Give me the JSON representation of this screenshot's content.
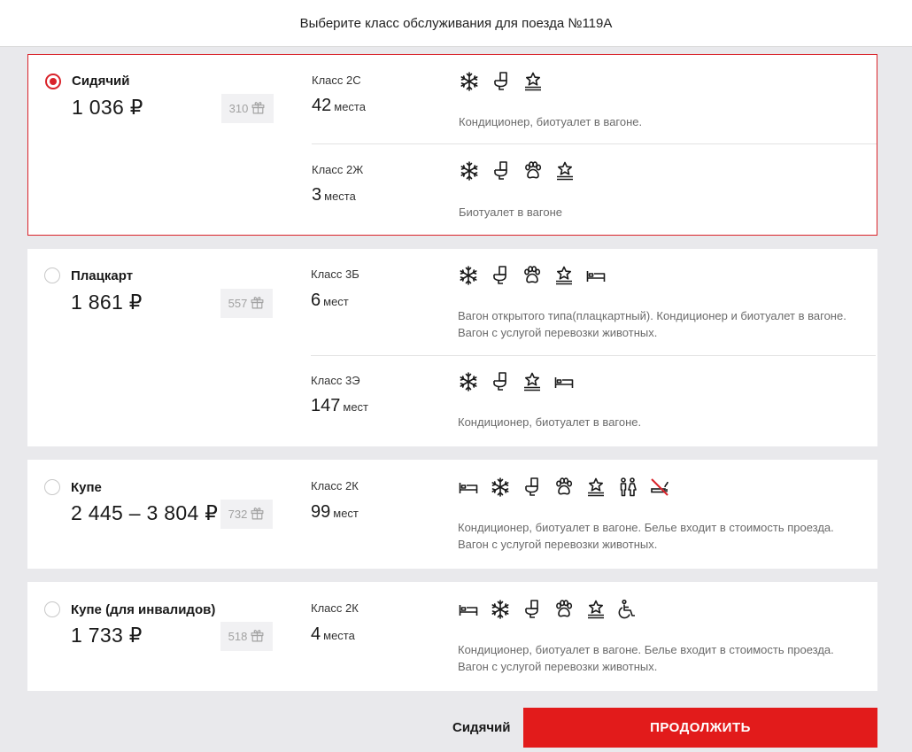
{
  "header": {
    "title": "Выберите класс обслуживания для поезда №119А"
  },
  "classes": [
    {
      "name": "Сидячий",
      "price": "1 036 ₽",
      "bonus": "310",
      "selected": true,
      "subclasses": [
        {
          "label": "Класс 2С",
          "seats": "42",
          "unit": "места",
          "icons": [
            "snowflake-icon",
            "toilet-icon",
            "service-icon"
          ],
          "desc": "Кондиционер, биотуалет в вагоне."
        },
        {
          "label": "Класс 2Ж",
          "seats": "3",
          "unit": "места",
          "icons": [
            "snowflake-icon",
            "toilet-icon",
            "paw-icon",
            "service-icon"
          ],
          "desc": "Биотуалет в вагоне"
        }
      ]
    },
    {
      "name": "Плацкарт",
      "price": "1 861 ₽",
      "bonus": "557",
      "selected": false,
      "subclasses": [
        {
          "label": "Класс 3Б",
          "seats": "6",
          "unit": "мест",
          "icons": [
            "snowflake-icon",
            "toilet-icon",
            "paw-icon",
            "service-icon",
            "bed-icon"
          ],
          "desc": "Вагон открытого типа(плацкартный). Кондиционер и биотуалет в вагоне. Вагон с услугой перевозки животных."
        },
        {
          "label": "Класс 3Э",
          "seats": "147",
          "unit": "мест",
          "icons": [
            "snowflake-icon",
            "toilet-icon",
            "service-icon",
            "bed-icon"
          ],
          "desc": "Кондиционер, биотуалет в вагоне."
        }
      ]
    },
    {
      "name": "Купе",
      "price": "2 445 – 3 804 ₽",
      "bonus": "732",
      "selected": false,
      "subclasses": [
        {
          "label": "Класс 2К",
          "seats": "99",
          "unit": "мест",
          "icons": [
            "bed-icon",
            "snowflake-icon",
            "toilet-icon",
            "paw-icon",
            "service-icon",
            "gender-icon",
            "no-smoking-icon"
          ],
          "desc": "Кондиционер, биотуалет в вагоне. Белье входит в стоимость проезда. Вагон с услугой перевозки животных."
        }
      ]
    },
    {
      "name": "Купе (для инвалидов)",
      "price": "1 733 ₽",
      "bonus": "518",
      "selected": false,
      "subclasses": [
        {
          "label": "Класс 2К",
          "seats": "4",
          "unit": "места",
          "icons": [
            "bed-icon",
            "snowflake-icon",
            "toilet-icon",
            "paw-icon",
            "service-icon",
            "wheelchair-icon"
          ],
          "desc": "Кондиционер, биотуалет в вагоне. Белье входит в стоимость проезда. Вагон с услугой перевозки животных."
        }
      ]
    }
  ],
  "footer": {
    "selected_label": "Сидячий",
    "continue_label": "ПРОДОЛЖИТЬ"
  },
  "colors": {
    "accent": "#e21b1b",
    "selected_border": "#d9232a"
  }
}
